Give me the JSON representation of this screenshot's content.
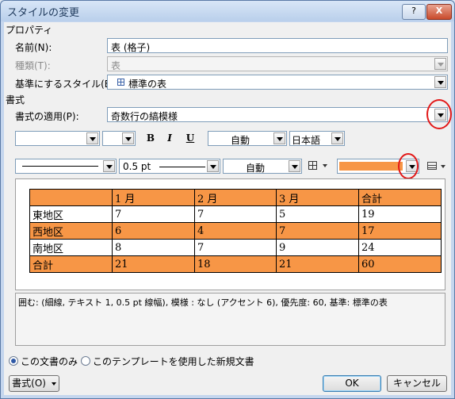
{
  "window": {
    "title": "スタイルの変更",
    "help_label": "?",
    "close_label": "X"
  },
  "properties": {
    "section_label": "プロパティ",
    "name_label": "名前(N):",
    "name_value": "表 (格子)",
    "type_label": "種類(T):",
    "type_value": "表",
    "based_on_label": "基準にするスタイル(B):",
    "based_on_value": "標準の表"
  },
  "format": {
    "section_label": "書式",
    "apply_to_label": "書式の適用(P):",
    "apply_to_value": "奇数行の縞模様",
    "font_size_value": "",
    "font_name_value": "",
    "bold_label": "B",
    "italic_label": "I",
    "underline_label": "U",
    "font_color_value": "自動",
    "language_value": "日本語",
    "line_weight_value": "0.5 pt",
    "border_color_value": "自動",
    "shading_color": "#f79646"
  },
  "preview_table": {
    "rows": [
      [
        "",
        "1 月",
        "2 月",
        "3 月",
        "合計"
      ],
      [
        "東地区",
        "7",
        "7",
        "5",
        "19"
      ],
      [
        "西地区",
        "6",
        "4",
        "7",
        "17"
      ],
      [
        "南地区",
        "8",
        "7",
        "9",
        "24"
      ],
      [
        "合計",
        "21",
        "18",
        "21",
        "60"
      ]
    ],
    "highlight_color": "#f79646"
  },
  "description": "囲む: (細線, テキスト 1,  0.5 pt 線幅), 模様 : なし (アクセント 6), 優先度: 60, 基準: 標準の表",
  "scope": {
    "option_this_doc": "この文書のみ",
    "option_template": "このテンプレートを使用した新規文書"
  },
  "buttons": {
    "format_label": "書式(O)",
    "ok_label": "OK",
    "cancel_label": "キャンセル"
  }
}
